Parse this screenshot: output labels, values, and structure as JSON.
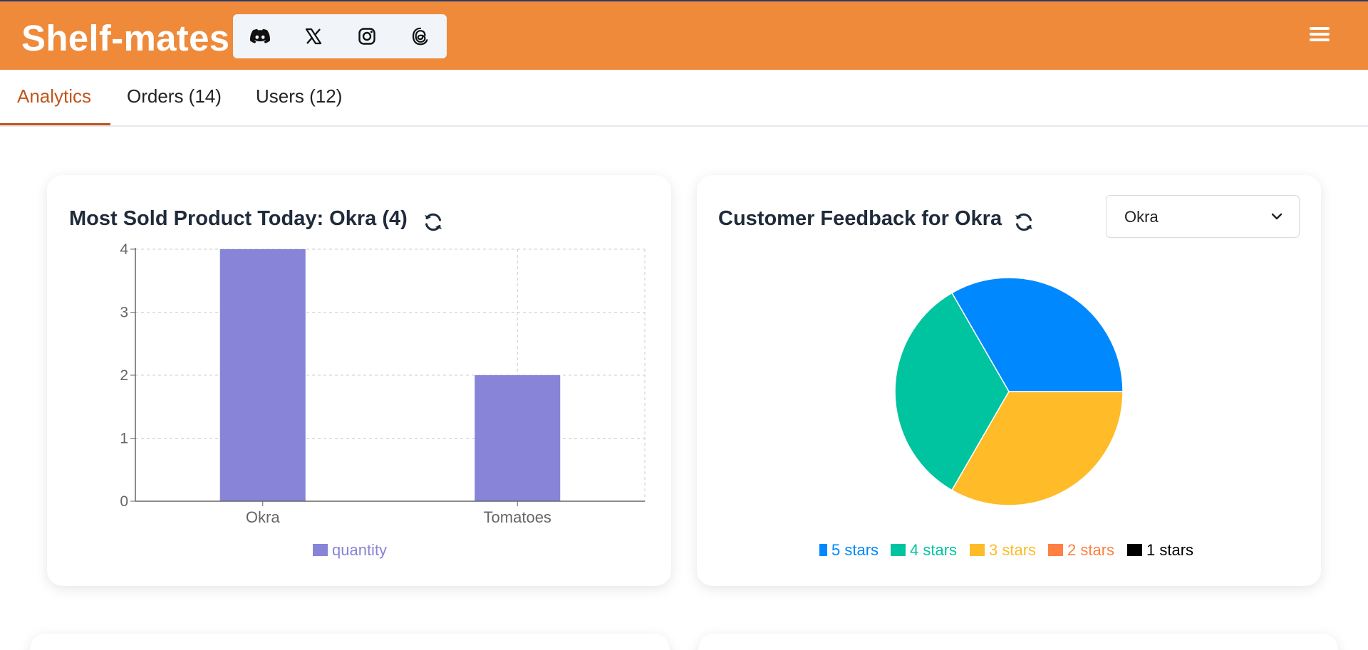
{
  "header": {
    "brand": "Shelf-mates",
    "bg_color": "#ee8a3a",
    "social_icons": [
      "discord-icon",
      "x-icon",
      "instagram-icon",
      "threads-icon"
    ],
    "menu_icon": "hamburger-menu-icon"
  },
  "tabs": [
    {
      "label": "Analytics",
      "active": true
    },
    {
      "label": "Orders (14)",
      "active": false
    },
    {
      "label": "Users (12)",
      "active": false
    }
  ],
  "accent_color": "#c0551c",
  "sales_card": {
    "title": "Most Sold Product Today: Okra (4)",
    "refresh_icon": "refresh-icon"
  },
  "feedback_card": {
    "title": "Customer Feedback for Okra",
    "refresh_icon": "refresh-icon",
    "select_value": "Okra"
  },
  "chart_data": [
    {
      "type": "bar",
      "categories": [
        "Okra",
        "Tomatoes"
      ],
      "series": [
        {
          "name": "quantity",
          "values": [
            4,
            2
          ],
          "color": "#8884d8"
        }
      ],
      "y_ticks": [
        0,
        1,
        2,
        3,
        4
      ],
      "ylim": [
        0,
        4
      ],
      "grid": true,
      "legend": "bottom"
    },
    {
      "type": "pie",
      "labels": [
        "5 stars",
        "4 stars",
        "3 stars",
        "2 stars",
        "1 stars"
      ],
      "values": [
        1,
        1,
        1,
        0,
        0
      ],
      "colors": [
        "#0088fe",
        "#00c49f",
        "#ffbb28",
        "#ff8042",
        "#000000"
      ],
      "legend": "bottom"
    }
  ]
}
